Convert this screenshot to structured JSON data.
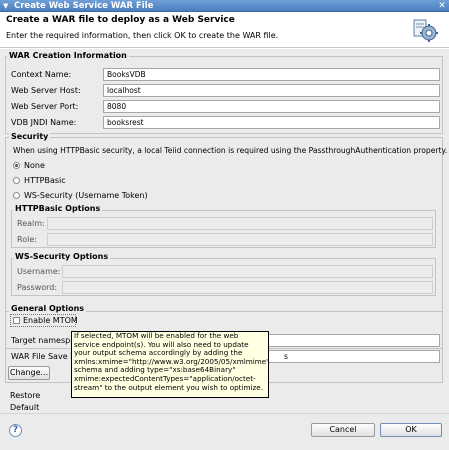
{
  "window": {
    "title": "Create Web Service WAR File",
    "close_glyph": "✕"
  },
  "banner": {
    "heading": "Create a WAR file to deploy as a Web Service",
    "description": "Enter the required information, then click OK to create the WAR file.",
    "icon": "war-file-gear-icon"
  },
  "war_creation": {
    "label": "WAR Creation Information",
    "fields": [
      {
        "label": "Context Name:",
        "value": "BooksVDB"
      },
      {
        "label": "Web Server Host:",
        "value": "localhost"
      },
      {
        "label": "Web Server Port:",
        "value": "8080"
      },
      {
        "label": "VDB JNDI Name:",
        "value": "booksrest"
      }
    ]
  },
  "security": {
    "label": "Security",
    "description": "When using HTTPBasic security, a local Teiid connection is required using the PassthroughAuthentication property.",
    "options": [
      {
        "label": "None",
        "selected": true
      },
      {
        "label": "HTTPBasic",
        "selected": false
      },
      {
        "label": "WS-Security (Username Token)",
        "selected": false
      }
    ]
  },
  "httpbasic": {
    "label": "HTTPBasic Options",
    "realm_label": "Realm:",
    "realm_value": "",
    "role_label": "Role:",
    "role_value": ""
  },
  "wssecurity": {
    "label": "WS-Security Options",
    "username_label": "Username:",
    "username_value": "",
    "password_label": "Password:",
    "password_value": ""
  },
  "general": {
    "label": "General Options",
    "mtom_label": "Enable MTOM",
    "mtom_checked": false,
    "target_namespace_label": "Target namespac",
    "target_namespace_value": "",
    "war_save_label": "WAR File Save L",
    "war_save_value": "s",
    "change_button": "Change...",
    "restore_default_button": "Restore Default"
  },
  "tooltip": {
    "lines": [
      "If selected, MTOM will be enabled for the web",
      "service endpoint(s). You will also need to update",
      "your output schema accordingly by adding the",
      "xmlns:xmime=\"http://www.w3.org/2005/05/xmlmime\"",
      "schema and adding type=\"xs:base64Binary\"",
      "xmime:expectedContentTypes=\"application/octet-",
      "stream\" to the output element you wish to optimize."
    ]
  },
  "footer": {
    "help_glyph": "?",
    "cancel_button": "Cancel",
    "ok_button": "OK"
  }
}
